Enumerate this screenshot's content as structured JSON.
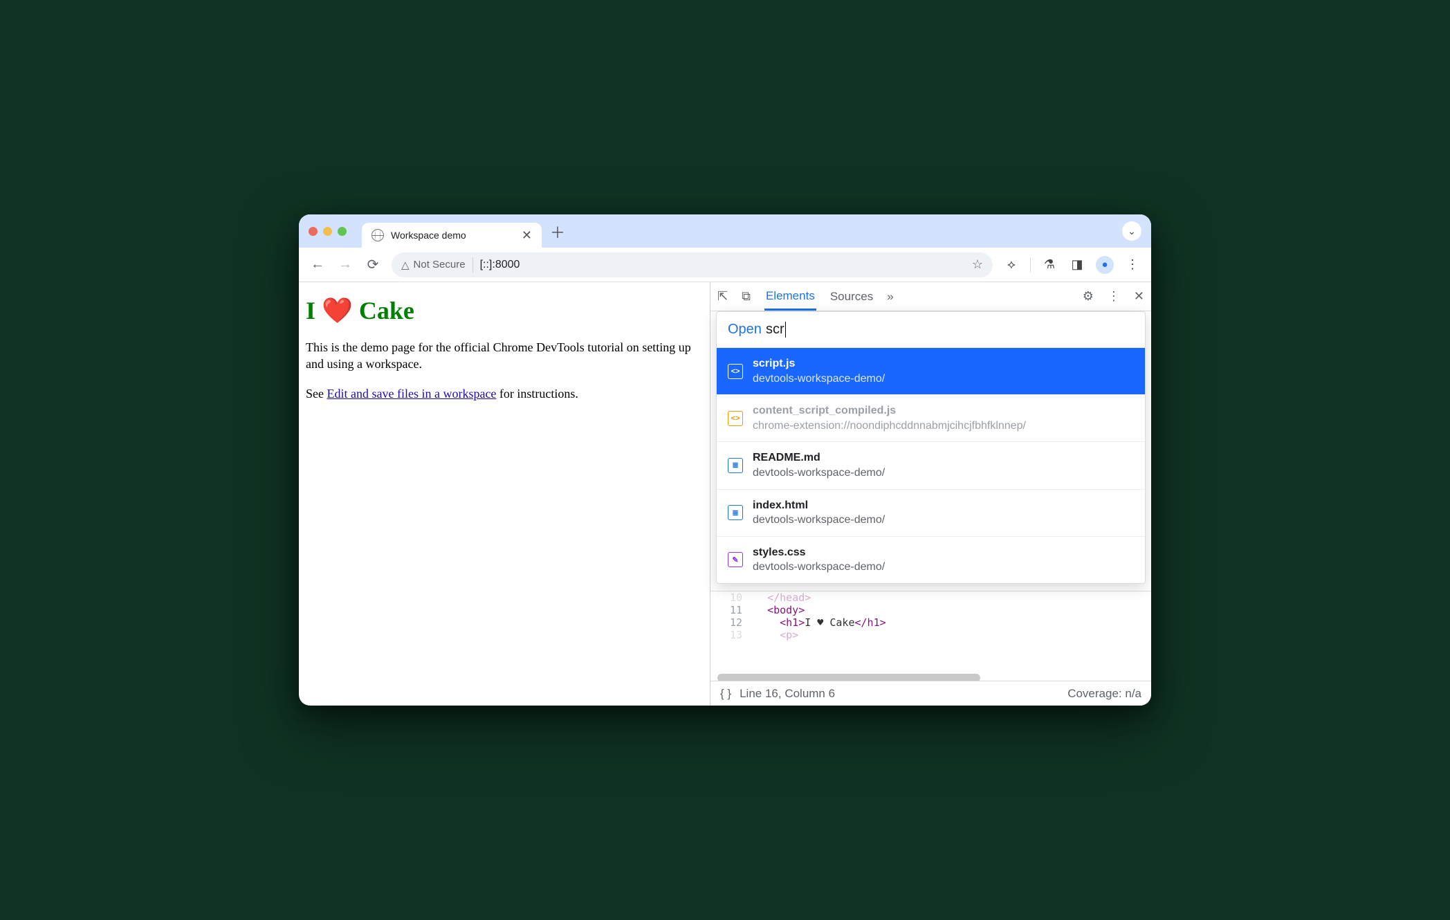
{
  "tab": {
    "title": "Workspace demo"
  },
  "omnibox": {
    "security_label": "Not Secure",
    "url": "[::]:8000"
  },
  "page": {
    "heading": "I ❤️ Cake",
    "p1_a": "This is the demo page for the official Chrome DevTools tutorial on ",
    "p1_b": "setting up and using a workspace.",
    "p2_a": "See ",
    "link": "Edit and save files in a workspace",
    "p2_b": " for instructions."
  },
  "devtools": {
    "tabs": {
      "elements": "Elements",
      "sources": "Sources",
      "more": "»"
    },
    "status": {
      "line_col": "Line 16, Column 6",
      "coverage": "Coverage: n/a"
    }
  },
  "cmd": {
    "label": "Open",
    "typed": "scr",
    "items": [
      {
        "title": "script.js",
        "sub": "devtools-workspace-demo/",
        "icon": "js",
        "selected": true,
        "dim": false
      },
      {
        "title": "content_script_compiled.js",
        "sub": "chrome-extension://noondiphcddnnabmjcihcjfbhfklnnep/",
        "icon": "jsx",
        "selected": false,
        "dim": true
      },
      {
        "title": "README.md",
        "sub": "devtools-workspace-demo/",
        "icon": "doc",
        "selected": false,
        "dim": false
      },
      {
        "title": "index.html",
        "sub": "devtools-workspace-demo/",
        "icon": "doc",
        "selected": false,
        "dim": false
      },
      {
        "title": "styles.css",
        "sub": "devtools-workspace-demo/",
        "icon": "css",
        "selected": false,
        "dim": false
      }
    ]
  },
  "code": {
    "lines": [
      {
        "n": "10",
        "html": "</head>",
        "indent": 1,
        "faded": true
      },
      {
        "n": "11",
        "html": "<body>",
        "indent": 1
      },
      {
        "n": "12",
        "html": "<h1>I ♥ Cake</h1>",
        "indent": 2
      },
      {
        "n": "13",
        "html": "<p>",
        "indent": 2,
        "faded": true
      }
    ]
  }
}
